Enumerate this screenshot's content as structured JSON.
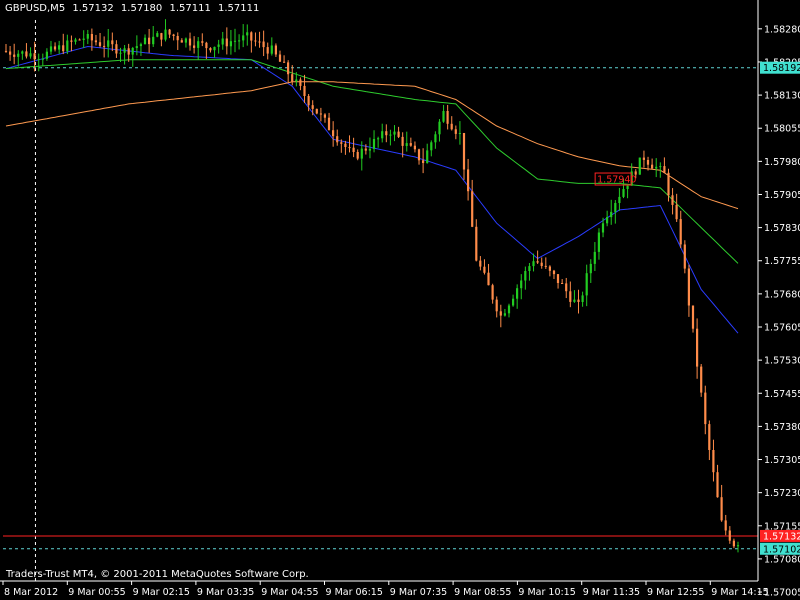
{
  "header": {
    "symbol": "GBPUSD,M5",
    "open": "1.57132",
    "high": "1.57180",
    "low": "1.57111",
    "close": "1.57111"
  },
  "copyright": "Traders-Trust MT4, © 2001-2011 MetaQuotes Software Corp.",
  "colors": {
    "background": "#000000",
    "axis": "#ffffff",
    "bull_candle": "#22cc22",
    "bear_candle": "#ff8c4a",
    "ma_fast": "#2a3cff",
    "ma_mid": "#2ecc2e",
    "ma_slow": "#ff9a50",
    "hline_dashed": "#5fd3d3",
    "hline_red": "#ff2222",
    "price_label_bg": "#40e0d0",
    "red_label": "#ff2222"
  },
  "chart_data": {
    "type": "candlestick",
    "ylim": [
      1.5703,
      1.583
    ],
    "y_ticks": [
      "1.58280",
      "1.58205",
      "1.58130",
      "1.58055",
      "1.57980",
      "1.57905",
      "1.57830",
      "1.57755",
      "1.57680",
      "1.57605",
      "1.57530",
      "1.57455",
      "1.57380",
      "1.57305",
      "1.57230",
      "1.57155",
      "1.57080",
      "1.57005"
    ],
    "x_ticks": [
      "8 Mar 2012",
      "9 Mar 00:55",
      "9 Mar 02:15",
      "9 Mar 03:35",
      "9 Mar 04:55",
      "9 Mar 06:15",
      "9 Mar 07:35",
      "9 Mar 08:55",
      "9 Mar 10:15",
      "9 Mar 11:35",
      "9 Mar 12:55",
      "9 Mar 14:15"
    ],
    "candle_count": 180,
    "path_points": [
      [
        0,
        1.5823
      ],
      [
        10,
        1.5822
      ],
      [
        20,
        1.5826
      ],
      [
        30,
        1.5823
      ],
      [
        40,
        1.5827
      ],
      [
        50,
        1.5824
      ],
      [
        60,
        1.5826
      ],
      [
        66,
        1.5823
      ],
      [
        70,
        1.5818
      ],
      [
        78,
        1.5808
      ],
      [
        86,
        1.5799
      ],
      [
        95,
        1.5805
      ],
      [
        103,
        1.5798
      ],
      [
        108,
        1.5809
      ],
      [
        112,
        1.5804
      ],
      [
        116,
        1.5776
      ],
      [
        122,
        1.5763
      ],
      [
        130,
        1.5776
      ],
      [
        136,
        1.5771
      ],
      [
        141,
        1.5765
      ],
      [
        147,
        1.5785
      ],
      [
        152,
        1.5792
      ],
      [
        157,
        1.5799
      ],
      [
        162,
        1.5795
      ],
      [
        166,
        1.578
      ],
      [
        172,
        1.5738
      ],
      [
        176,
        1.5716
      ],
      [
        180,
        1.571
      ]
    ],
    "series": [
      {
        "name": "",
        "values": [
          [
            0,
            1.5819
          ],
          [
            20,
            1.5824
          ],
          [
            40,
            1.5822
          ],
          [
            60,
            1.5821
          ],
          [
            70,
            1.5815
          ],
          [
            80,
            1.5803
          ],
          [
            100,
            1.5799
          ],
          [
            110,
            1.5796
          ],
          [
            120,
            1.5784
          ],
          [
            130,
            1.5776
          ],
          [
            140,
            1.5781
          ],
          [
            150,
            1.5787
          ],
          [
            160,
            1.5788
          ],
          [
            170,
            1.5769
          ],
          [
            180,
            1.5758
          ]
        ]
      },
      {
        "name": "",
        "values": [
          [
            0,
            1.5819
          ],
          [
            30,
            1.5821
          ],
          [
            60,
            1.5821
          ],
          [
            70,
            1.5818
          ],
          [
            80,
            1.5815
          ],
          [
            100,
            1.5812
          ],
          [
            110,
            1.5811
          ],
          [
            120,
            1.5801
          ],
          [
            130,
            1.5794
          ],
          [
            140,
            1.5793
          ],
          [
            150,
            1.5793
          ],
          [
            160,
            1.5792
          ],
          [
            170,
            1.5783
          ],
          [
            180,
            1.5774
          ]
        ]
      },
      {
        "name": "",
        "values": [
          [
            0,
            1.5806
          ],
          [
            30,
            1.5811
          ],
          [
            60,
            1.5814
          ],
          [
            70,
            1.5816
          ],
          [
            80,
            1.5816
          ],
          [
            100,
            1.5815
          ],
          [
            110,
            1.5812
          ],
          [
            120,
            1.5806
          ],
          [
            130,
            1.5802
          ],
          [
            140,
            1.5799
          ],
          [
            150,
            1.5797
          ],
          [
            160,
            1.5796
          ],
          [
            170,
            1.579
          ],
          [
            180,
            1.5787
          ]
        ]
      }
    ],
    "horizontal_lines": [
      {
        "y": 1.58192,
        "style": "dashed",
        "label": "1.58192"
      },
      {
        "y": 1.57103,
        "style": "dashed",
        "label": "1.57102"
      },
      {
        "y": 1.57132,
        "style": "solid-red",
        "label": "1.57132"
      }
    ],
    "vertical_line": {
      "x_index": 5,
      "style": "dashed"
    },
    "annotations": [
      {
        "text": "1.57940",
        "x_index": 147,
        "y": 1.5794
      }
    ]
  }
}
